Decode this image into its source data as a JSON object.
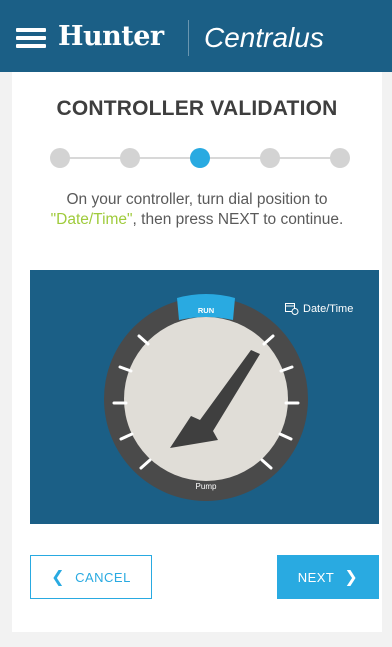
{
  "header": {
    "brand": "Hunter",
    "app_name": "Centralus"
  },
  "page": {
    "title": "CONTROLLER VALIDATION",
    "steps": {
      "total": 5,
      "active_index": 2
    },
    "instruction_before": "On your controller, turn dial position to ",
    "instruction_highlight": "\"Date/Time\"",
    "instruction_after": ", then press NEXT to continue."
  },
  "dial": {
    "top_label": "RUN",
    "bottom_label": "Pump",
    "side_label": "Date/Time",
    "colors": {
      "panel": "#1b5f86",
      "ring": "#4a4a4a",
      "face": "#e0ddd7",
      "pointer": "#3f3f3f",
      "run_tab": "#29aae1"
    }
  },
  "buttons": {
    "cancel_label": "CANCEL",
    "next_label": "NEXT"
  },
  "colors": {
    "header_bg": "#1b5f86",
    "accent": "#29aae1",
    "highlight_text": "#9fcb3b"
  }
}
